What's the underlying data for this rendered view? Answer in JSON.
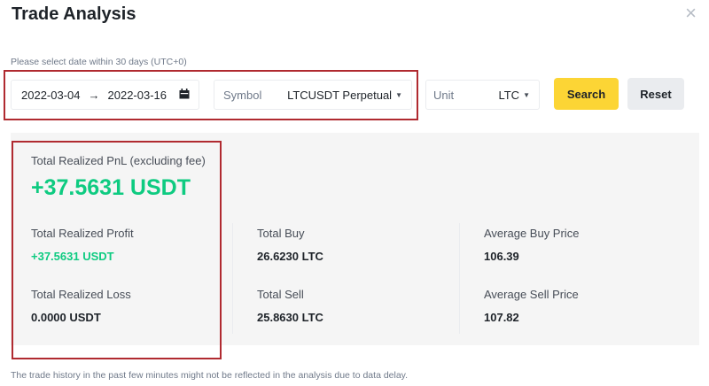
{
  "dialog": {
    "title": "Trade Analysis",
    "close_glyph": "×"
  },
  "filters": {
    "hint": "Please select date within 30 days (UTC+0)",
    "date_start": "2022-03-04",
    "date_arrow": "→",
    "date_end": "2022-03-16",
    "symbol_label": "Symbol",
    "symbol_value": "LTCUSDT Perpetual",
    "unit_label": "Unit",
    "unit_value": "LTC",
    "search_label": "Search",
    "reset_label": "Reset"
  },
  "summary": {
    "pnl_label": "Total Realized PnL (excluding fee)",
    "pnl_value": "+37.5631 USDT",
    "profit_label": "Total Realized Profit",
    "profit_value": "+37.5631 USDT",
    "loss_label": "Total Realized Loss",
    "loss_value": "0.0000 USDT",
    "total_buy_label": "Total Buy",
    "total_buy_value": "26.6230 LTC",
    "total_sell_label": "Total Sell",
    "total_sell_value": "25.8630 LTC",
    "avg_buy_label": "Average Buy Price",
    "avg_buy_value": "106.39",
    "avg_sell_label": "Average Sell Price",
    "avg_sell_value": "107.82"
  },
  "footer": {
    "note": "The trade history in the past few minutes might not be reflected in the analysis due to data delay."
  },
  "colors": {
    "accent": "#fcd535",
    "positive": "#0ecb81",
    "highlight_box": "#b02a30"
  },
  "icons": {
    "close": "close-icon",
    "calendar": "calendar-icon",
    "dropdown": "caret-down-icon"
  }
}
